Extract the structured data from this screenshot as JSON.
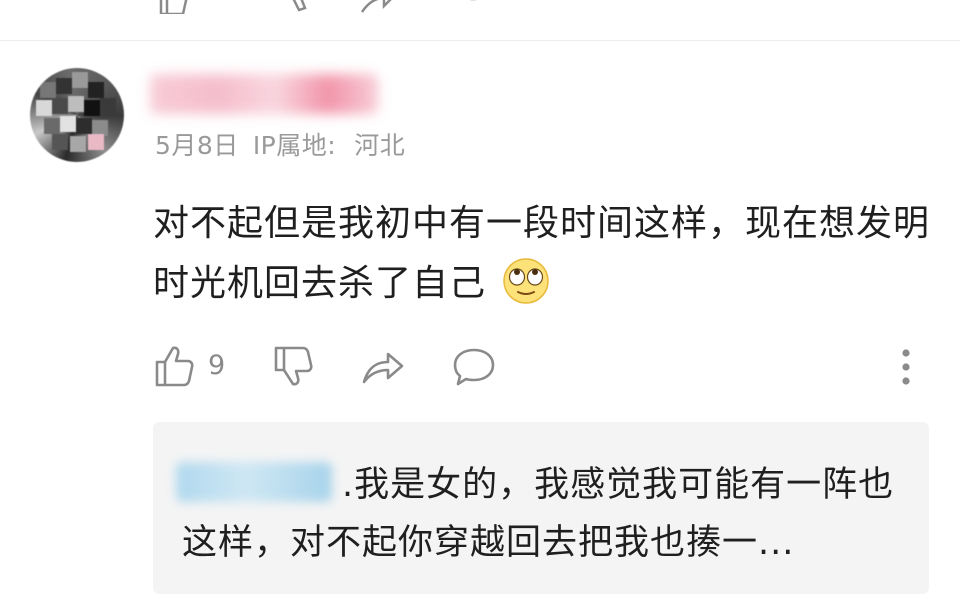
{
  "comment": {
    "username": "",
    "date": "5月8日",
    "ip_label": "IP属地:",
    "ip_location": "河北",
    "text": "对不起但是我初中有一段时间这样，现在想发明时光机回去杀了自己",
    "emoji": "rolling-eyes-emoji",
    "likes": "9"
  },
  "reply": {
    "username": "",
    "separator": ".",
    "text": "我是女的，我感觉我可能有一阵也这样，对不起你穿越回去把我也揍一..."
  },
  "icons": {
    "like": "thumbs-up-icon",
    "dislike": "thumbs-down-icon",
    "share": "share-icon",
    "reply": "comment-icon",
    "more": "more-vertical-icon"
  },
  "colors": {
    "meta_text": "#9a9a9a",
    "icon": "#8a8a8a",
    "reply_bg": "#f4f4f4"
  }
}
